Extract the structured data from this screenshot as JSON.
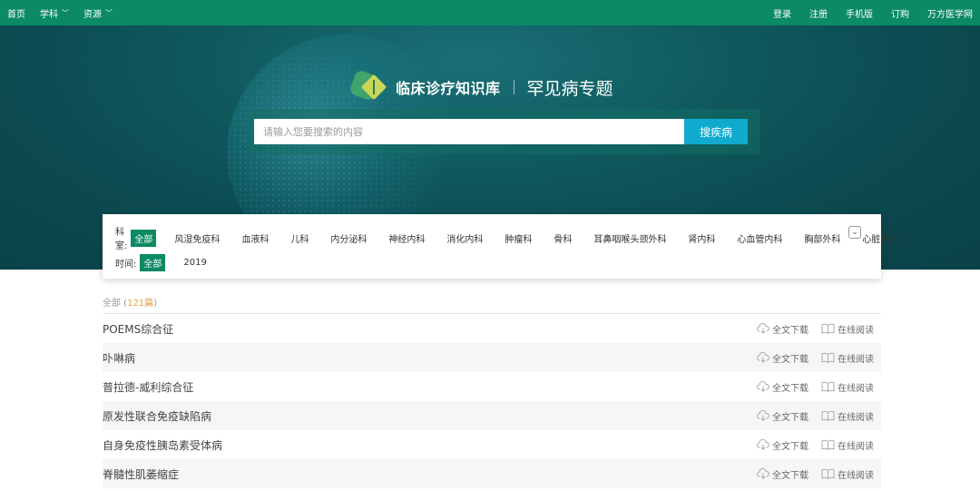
{
  "topbar": {
    "left": [
      {
        "label": "首页",
        "has_dropdown": false
      },
      {
        "label": "学科",
        "has_dropdown": true
      },
      {
        "label": "资源",
        "has_dropdown": true
      }
    ],
    "right": [
      "登录",
      "注册",
      "手机版",
      "订购",
      "万方医学网"
    ]
  },
  "brand": {
    "name": "临床诊疗知识库",
    "topic": "罕见病专题"
  },
  "search": {
    "placeholder": "请输入您要搜索的内容",
    "button": "搜疾病"
  },
  "filter": {
    "department_label": "科室:",
    "departments": [
      "全部",
      "风湿免疫科",
      "血液科",
      "儿科",
      "内分泌科",
      "神经内科",
      "消化内科",
      "肿瘤科",
      "骨科",
      "耳鼻咽喉头颈外科",
      "肾内科",
      "心血管内科",
      "胸部外科",
      "心脏外科"
    ],
    "department_active": "全部",
    "time_label": "时间:",
    "times": [
      "全部",
      "2019"
    ],
    "time_active": "全部"
  },
  "results": {
    "summary_label": "全部",
    "count_text": "121篇",
    "download_label": "全文下载",
    "read_label": "在线阅读",
    "items": [
      "POEMS综合征",
      "卟啉病",
      "普拉德-威利综合征",
      "原发性联合免疫缺陷病",
      "自身免疫性胰岛素受体病",
      "脊髓性肌萎缩症"
    ]
  },
  "colors": {
    "nav_green": "#0b8a63",
    "search_button": "#11aacf",
    "count_orange": "#e4a64a"
  },
  "icons": {
    "download": "cloud-download-icon",
    "read": "open-book-icon",
    "expand": "chevron-down-icon"
  }
}
